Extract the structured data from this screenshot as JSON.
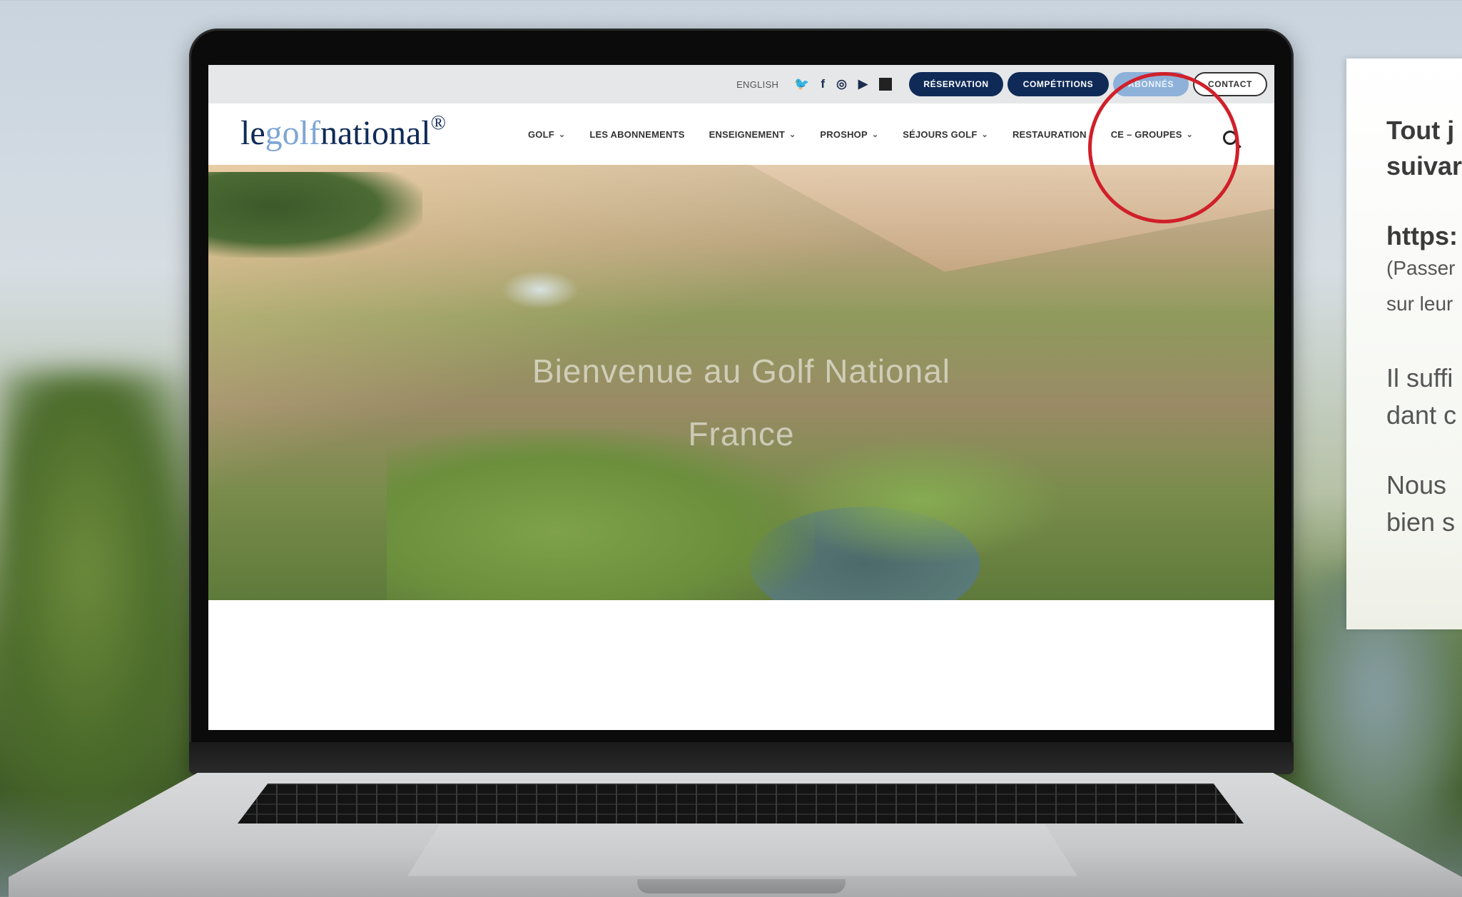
{
  "topbar": {
    "language": "ENGLISH",
    "social_icons": [
      "twitter-icon",
      "facebook-icon",
      "instagram-icon",
      "youtube-icon",
      "qr-code-icon"
    ],
    "buttons": {
      "reservation": "RÉSERVATION",
      "competitions": "COMPÉTITIONS",
      "abonnes": "ABONNÉS",
      "contact": "CONTACT"
    }
  },
  "logo": {
    "part1": "le",
    "part2": "golf",
    "part3": "national",
    "mark": "®"
  },
  "nav": {
    "items": [
      {
        "label": "GOLF",
        "dropdown": true
      },
      {
        "label": "LES ABONNEMENTS",
        "dropdown": false
      },
      {
        "label": "ENSEIGNEMENT",
        "dropdown": true
      },
      {
        "label": "PROSHOP",
        "dropdown": true
      },
      {
        "label": "SÉJOURS GOLF",
        "dropdown": true
      },
      {
        "label": "RESTAURATION",
        "dropdown": false
      },
      {
        "label": "CE – GROUPES",
        "dropdown": true
      }
    ]
  },
  "hero": {
    "line1": "Bienvenue au Golf National",
    "line2": "France"
  },
  "side_panel": {
    "line1": "Tout j",
    "line2": "suivar",
    "line3": "https:",
    "line4": "(Passer",
    "line5": "sur leur",
    "line6": "Il suffi",
    "line7": "dant c",
    "line8": "Nous",
    "line9": "bien s"
  },
  "colors": {
    "navy": "#0f2a57",
    "light_blue": "#8db1d9",
    "annotation_red": "#d0202a"
  }
}
